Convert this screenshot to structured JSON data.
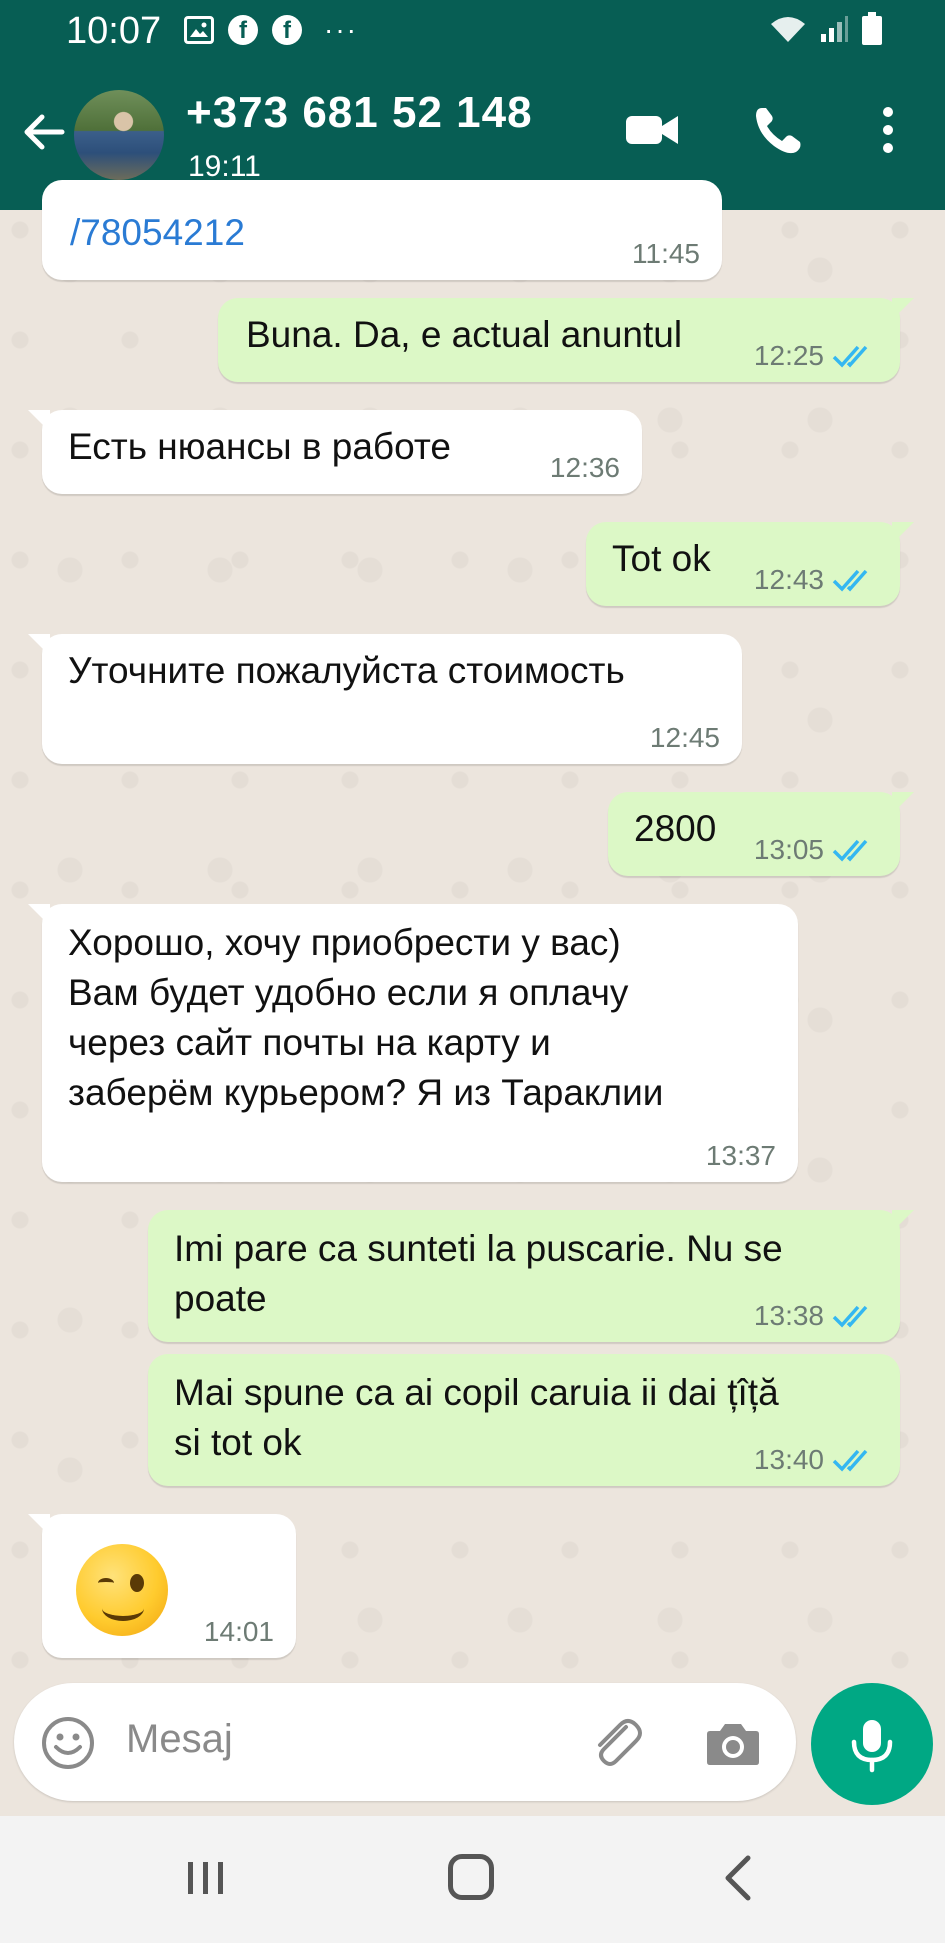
{
  "status_bar": {
    "time": "10:07",
    "icons": [
      "image-icon",
      "facebook-icon",
      "facebook-icon",
      "more-dots-icon",
      "wifi-icon",
      "signal-icon",
      "battery-icon"
    ]
  },
  "header": {
    "contact_name": "+373 681 52 148",
    "status": "19:11",
    "icons": [
      "back-arrow-icon",
      "video-call-icon",
      "voice-call-icon",
      "overflow-menu-icon"
    ]
  },
  "messages": [
    {
      "dir": "in",
      "text": "/78054212",
      "time": "11:45",
      "is_link": true
    },
    {
      "dir": "out",
      "text": "Buna. Da, e actual anuntul",
      "time": "12:25",
      "read": true
    },
    {
      "dir": "in",
      "text": "Есть нюансы в работе",
      "time": "12:36"
    },
    {
      "dir": "out",
      "text": "Tot ok",
      "time": "12:43",
      "read": true
    },
    {
      "dir": "in",
      "text": "Уточните пожалуйста стоимость",
      "time": "12:45"
    },
    {
      "dir": "out",
      "text": "2800",
      "time": "13:05",
      "read": true
    },
    {
      "dir": "in",
      "text": "Хорошо, хочу приобрести у вас)\nВам будет удобно если я оплачу\nчерез сайт почты на карту и\nзаберём курьером? Я из Тараклии",
      "time": "13:37"
    },
    {
      "dir": "out",
      "text": "Imi pare ca sunteti la puscarie. Nu se\npoate",
      "time": "13:38",
      "read": true
    },
    {
      "dir": "out",
      "text": "Mai spune ca ai copil caruia ii dai țîță\nsi tot ok",
      "time": "13:40",
      "read": true
    },
    {
      "dir": "in",
      "emoji": "winking-face-emoji",
      "time": "14:01"
    }
  ],
  "composer": {
    "placeholder": "Mesaj",
    "icons": [
      "emoji-icon",
      "attach-icon",
      "camera-icon",
      "mic-icon"
    ]
  },
  "colors": {
    "header": "#075e54",
    "outgoing_bubble": "#dcf8c6",
    "incoming_bubble": "#ffffff",
    "chat_bg": "#ece5dd",
    "accent": "#00a884",
    "tick_read": "#34b7f1"
  }
}
